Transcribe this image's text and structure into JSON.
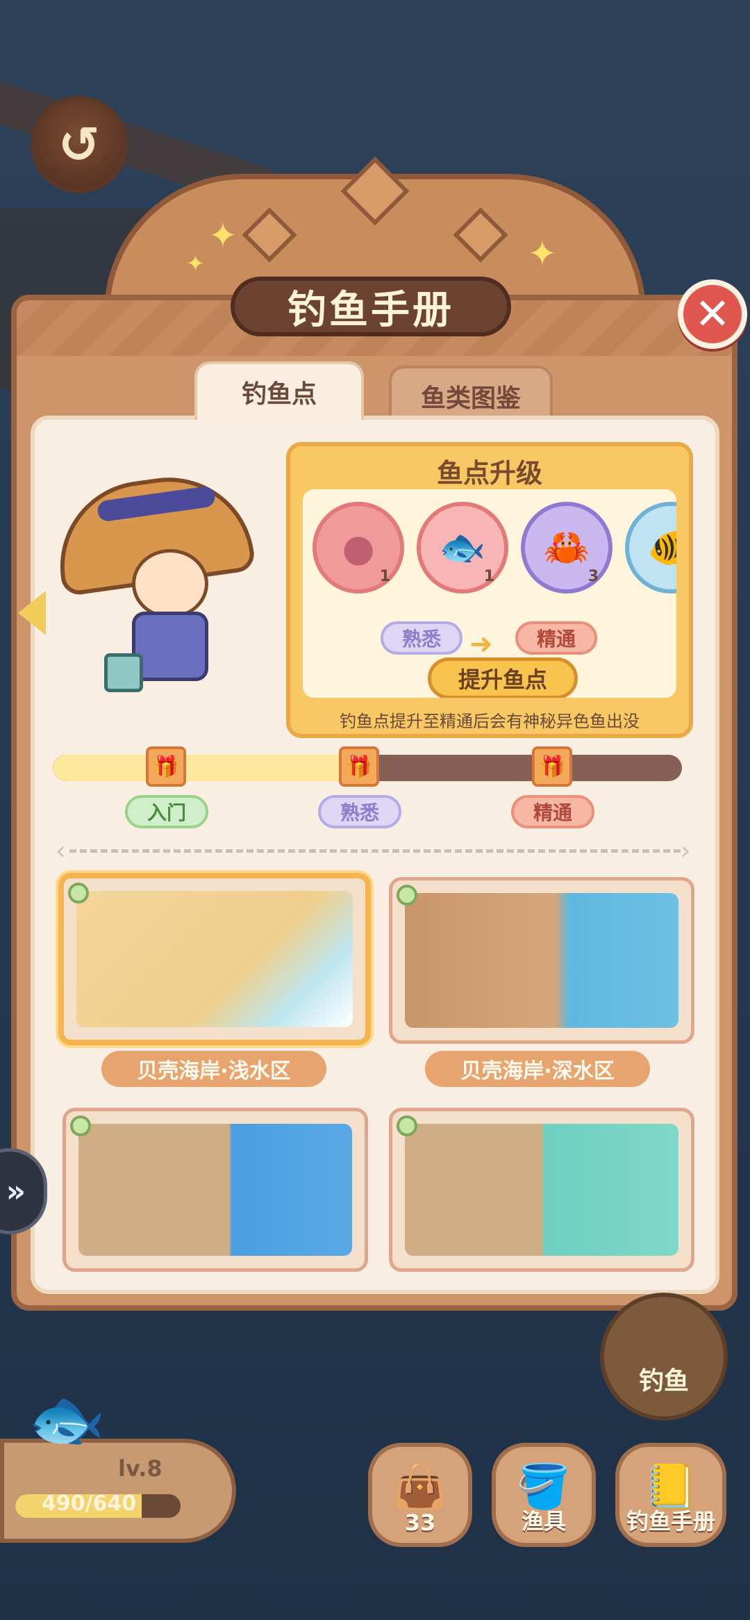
{
  "title": "钓鱼手册",
  "tabs": [
    {
      "label": "钓鱼点"
    },
    {
      "label": "鱼类图鉴"
    }
  ],
  "upgrade": {
    "title": "鱼点升级",
    "fish": [
      {
        "icon": "unknown-fish",
        "count": "1"
      },
      {
        "icon": "rainbow-fish",
        "count": "1"
      },
      {
        "icon": "hermit-crab",
        "count": "3"
      }
    ],
    "from_level": "熟悉",
    "to_level": "精通",
    "button": "提升鱼点",
    "note": "钓鱼点提升至精通后会有神秘异色鱼出没"
  },
  "progress": {
    "fill_fraction": 0.49,
    "stages": [
      "入门",
      "熟悉",
      "精通"
    ]
  },
  "spots": [
    {
      "name": "贝壳海岸·浅水区",
      "selected": true
    },
    {
      "name": "贝壳海岸·深水区",
      "selected": false
    },
    {
      "name": "",
      "selected": false
    },
    {
      "name": "",
      "selected": false
    }
  ],
  "hud": {
    "fish_button": "钓鱼",
    "level": "lv.8",
    "xp_text": "490/640",
    "xp_fraction": 0.766,
    "bag_count": "33",
    "gear_label": "渔具",
    "handbook_label": "钓鱼手册"
  },
  "colors": {
    "panel": "#cf956a",
    "accent_gold": "#f8c864",
    "close_red": "#e0574f"
  }
}
